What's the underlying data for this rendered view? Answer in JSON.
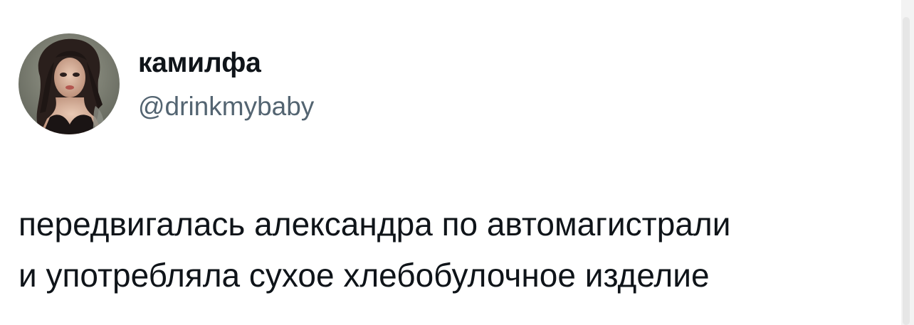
{
  "author": {
    "display_name": "камилфа",
    "handle": "@drinkmybaby",
    "avatar_icon": "avatar-photo"
  },
  "tweet": {
    "lines": [
      "передвигалась александра по автомагистрали",
      "и употребляла сухое хлебобулочное изделие"
    ]
  },
  "colors": {
    "text_primary": "#0f1419",
    "text_secondary": "#536471",
    "background": "#ffffff"
  }
}
